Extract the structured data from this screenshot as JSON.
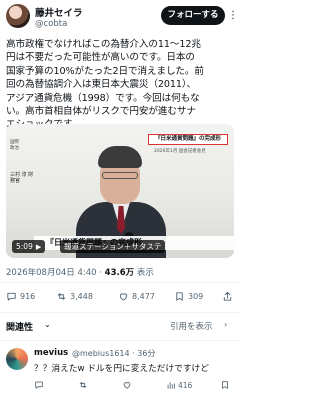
{
  "author": {
    "name": "藤井セイラ",
    "handle": "@cobta",
    "follow_label": "フォローする",
    "more_label": "⋮"
  },
  "post": {
    "lines": [
      "高市政権でなければこの為替介入の11〜12兆",
      "円は不要だった可能性が高いのです。日本の",
      "国家予算の10%がたった2日で消えました。前",
      "回の為替協調介入は東日本大震災（2011）、",
      "アジア通貨危機（1998）です。今回は何もな",
      "い。高市首相自体がリスクで円安が進むサナ",
      "エショックです。"
    ]
  },
  "media": {
    "banner": "『日米通貨問題』の完成形",
    "banner_sub": "2026年1月 国会記者会見",
    "side_label": "国際政治",
    "side_name": "三村 淳 財務官",
    "caption": "『日米通貨問題』の完成形",
    "duration": "5:09",
    "play_icon": "▶",
    "channel": "報道ステーション＋サタステ"
  },
  "meta": {
    "timestamp": "2026年08月04日 4:40 · ",
    "views_count": "43.6万",
    "views_label": " 表示"
  },
  "stats": {
    "replies": "916",
    "reposts": "3,448",
    "likes": "8,477",
    "bookmarks": "309"
  },
  "related": {
    "label": "関連性",
    "chevron": "⌄",
    "quote_label": "引用を表示",
    "quote_chevron": "›"
  },
  "reply": {
    "name": "mevius",
    "handle": "@mebius1614 · 36分",
    "text": "？？消えたw ドルを円に変えただけですけど",
    "replies": "",
    "reposts": "",
    "likes": "",
    "views": "416"
  }
}
